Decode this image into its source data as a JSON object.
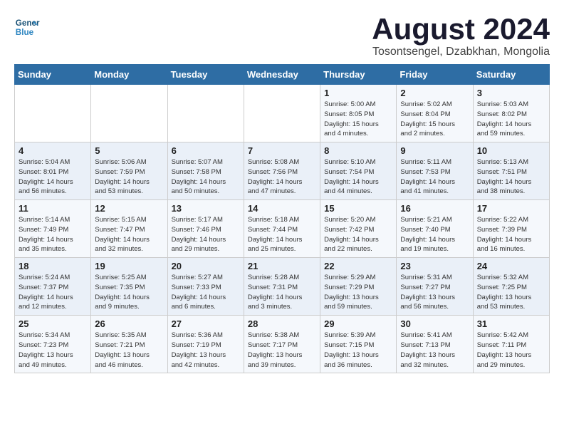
{
  "logo": {
    "line1": "General",
    "line2": "Blue"
  },
  "title": "August 2024",
  "subtitle": "Tosontsengel, Dzabkhan, Mongolia",
  "days_of_week": [
    "Sunday",
    "Monday",
    "Tuesday",
    "Wednesday",
    "Thursday",
    "Friday",
    "Saturday"
  ],
  "weeks": [
    [
      {
        "day": "",
        "info": ""
      },
      {
        "day": "",
        "info": ""
      },
      {
        "day": "",
        "info": ""
      },
      {
        "day": "",
        "info": ""
      },
      {
        "day": "1",
        "info": "Sunrise: 5:00 AM\nSunset: 8:05 PM\nDaylight: 15 hours\nand 4 minutes."
      },
      {
        "day": "2",
        "info": "Sunrise: 5:02 AM\nSunset: 8:04 PM\nDaylight: 15 hours\nand 2 minutes."
      },
      {
        "day": "3",
        "info": "Sunrise: 5:03 AM\nSunset: 8:02 PM\nDaylight: 14 hours\nand 59 minutes."
      }
    ],
    [
      {
        "day": "4",
        "info": "Sunrise: 5:04 AM\nSunset: 8:01 PM\nDaylight: 14 hours\nand 56 minutes."
      },
      {
        "day": "5",
        "info": "Sunrise: 5:06 AM\nSunset: 7:59 PM\nDaylight: 14 hours\nand 53 minutes."
      },
      {
        "day": "6",
        "info": "Sunrise: 5:07 AM\nSunset: 7:58 PM\nDaylight: 14 hours\nand 50 minutes."
      },
      {
        "day": "7",
        "info": "Sunrise: 5:08 AM\nSunset: 7:56 PM\nDaylight: 14 hours\nand 47 minutes."
      },
      {
        "day": "8",
        "info": "Sunrise: 5:10 AM\nSunset: 7:54 PM\nDaylight: 14 hours\nand 44 minutes."
      },
      {
        "day": "9",
        "info": "Sunrise: 5:11 AM\nSunset: 7:53 PM\nDaylight: 14 hours\nand 41 minutes."
      },
      {
        "day": "10",
        "info": "Sunrise: 5:13 AM\nSunset: 7:51 PM\nDaylight: 14 hours\nand 38 minutes."
      }
    ],
    [
      {
        "day": "11",
        "info": "Sunrise: 5:14 AM\nSunset: 7:49 PM\nDaylight: 14 hours\nand 35 minutes."
      },
      {
        "day": "12",
        "info": "Sunrise: 5:15 AM\nSunset: 7:47 PM\nDaylight: 14 hours\nand 32 minutes."
      },
      {
        "day": "13",
        "info": "Sunrise: 5:17 AM\nSunset: 7:46 PM\nDaylight: 14 hours\nand 29 minutes."
      },
      {
        "day": "14",
        "info": "Sunrise: 5:18 AM\nSunset: 7:44 PM\nDaylight: 14 hours\nand 25 minutes."
      },
      {
        "day": "15",
        "info": "Sunrise: 5:20 AM\nSunset: 7:42 PM\nDaylight: 14 hours\nand 22 minutes."
      },
      {
        "day": "16",
        "info": "Sunrise: 5:21 AM\nSunset: 7:40 PM\nDaylight: 14 hours\nand 19 minutes."
      },
      {
        "day": "17",
        "info": "Sunrise: 5:22 AM\nSunset: 7:39 PM\nDaylight: 14 hours\nand 16 minutes."
      }
    ],
    [
      {
        "day": "18",
        "info": "Sunrise: 5:24 AM\nSunset: 7:37 PM\nDaylight: 14 hours\nand 12 minutes."
      },
      {
        "day": "19",
        "info": "Sunrise: 5:25 AM\nSunset: 7:35 PM\nDaylight: 14 hours\nand 9 minutes."
      },
      {
        "day": "20",
        "info": "Sunrise: 5:27 AM\nSunset: 7:33 PM\nDaylight: 14 hours\nand 6 minutes."
      },
      {
        "day": "21",
        "info": "Sunrise: 5:28 AM\nSunset: 7:31 PM\nDaylight: 14 hours\nand 3 minutes."
      },
      {
        "day": "22",
        "info": "Sunrise: 5:29 AM\nSunset: 7:29 PM\nDaylight: 13 hours\nand 59 minutes."
      },
      {
        "day": "23",
        "info": "Sunrise: 5:31 AM\nSunset: 7:27 PM\nDaylight: 13 hours\nand 56 minutes."
      },
      {
        "day": "24",
        "info": "Sunrise: 5:32 AM\nSunset: 7:25 PM\nDaylight: 13 hours\nand 53 minutes."
      }
    ],
    [
      {
        "day": "25",
        "info": "Sunrise: 5:34 AM\nSunset: 7:23 PM\nDaylight: 13 hours\nand 49 minutes."
      },
      {
        "day": "26",
        "info": "Sunrise: 5:35 AM\nSunset: 7:21 PM\nDaylight: 13 hours\nand 46 minutes."
      },
      {
        "day": "27",
        "info": "Sunrise: 5:36 AM\nSunset: 7:19 PM\nDaylight: 13 hours\nand 42 minutes."
      },
      {
        "day": "28",
        "info": "Sunrise: 5:38 AM\nSunset: 7:17 PM\nDaylight: 13 hours\nand 39 minutes."
      },
      {
        "day": "29",
        "info": "Sunrise: 5:39 AM\nSunset: 7:15 PM\nDaylight: 13 hours\nand 36 minutes."
      },
      {
        "day": "30",
        "info": "Sunrise: 5:41 AM\nSunset: 7:13 PM\nDaylight: 13 hours\nand 32 minutes."
      },
      {
        "day": "31",
        "info": "Sunrise: 5:42 AM\nSunset: 7:11 PM\nDaylight: 13 hours\nand 29 minutes."
      }
    ]
  ]
}
